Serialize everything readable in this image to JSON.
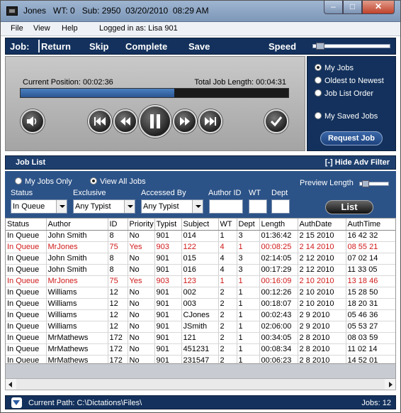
{
  "window": {
    "title_name": "Jones",
    "title_wt": "WT: 0",
    "title_sub": "Sub: 2950",
    "title_date": "03/20/2010",
    "title_time": "08:29 AM"
  },
  "menu": {
    "file": "File",
    "view": "View",
    "help": "Help",
    "logged_in": "Logged in as: Lisa 901"
  },
  "toolbar": {
    "job": "Job:",
    "return": "Return",
    "skip": "Skip",
    "complete": "Complete",
    "save": "Save",
    "speed": "Speed"
  },
  "player": {
    "current_position": "Current Position: 00:02:36",
    "total_length": "Total Job Length: 00:04:31",
    "progress_fraction": 0.575
  },
  "side": {
    "my_jobs": "My Jobs",
    "oldest_to_newest": "Oldest to Newest",
    "job_list_order": "Job List Order",
    "my_saved_jobs": "My Saved Jobs",
    "request_job": "Request Job"
  },
  "joblist": {
    "label": "Job List",
    "hide_adv": "[-] Hide Adv Filter"
  },
  "filter": {
    "my_jobs_only": "My Jobs Only",
    "view_all_jobs": "View All Jobs",
    "preview_length": "Preview Length",
    "status_label": "Status",
    "status_value": "In Queue",
    "exclusive_label": "Exclusive",
    "exclusive_value": "Any Typist",
    "accessed_by_label": "Accessed By",
    "accessed_by_value": "Any Typist",
    "author_id_label": "Author ID",
    "wt_label": "WT",
    "dept_label": "Dept",
    "list_button": "List"
  },
  "table": {
    "columns": [
      "Status",
      "Author",
      "ID",
      "Priority",
      "Typist",
      "Subject",
      "WT",
      "Dept",
      "Length",
      "AuthDate",
      "AuthTime"
    ],
    "rows": [
      {
        "c": [
          "In Queue",
          "John Smith",
          "8",
          "No",
          "901",
          "014",
          "1",
          "3",
          "01:36:42",
          "2 15 2010",
          "16 42 32"
        ],
        "red": false
      },
      {
        "c": [
          "In Queue",
          "MrJones",
          "75",
          "Yes",
          "903",
          "122",
          "4",
          "1",
          "00:08:25",
          "2 14 2010",
          "08 55 21"
        ],
        "red": true
      },
      {
        "c": [
          "In Queue",
          "John Smith",
          "8",
          "No",
          "901",
          "015",
          "4",
          "3",
          "02:14:05",
          "2 12 2010",
          "07 02 14"
        ],
        "red": false
      },
      {
        "c": [
          "In Queue",
          "John Smith",
          "8",
          "No",
          "901",
          "016",
          "4",
          "3",
          "00:17:29",
          "2 12 2010",
          "11 33 05"
        ],
        "red": false
      },
      {
        "c": [
          "In Queue",
          "MrJones",
          "75",
          "Yes",
          "903",
          "123",
          "1",
          "1",
          "00:16:09",
          "2 10 2010",
          "13 18 46"
        ],
        "red": true
      },
      {
        "c": [
          "In Queue",
          "Williams",
          "12",
          "No",
          "901",
          "002",
          "2",
          "1",
          "00:12:26",
          "2 10 2010",
          "15 28 50"
        ],
        "red": false
      },
      {
        "c": [
          "In Queue",
          "Williams",
          "12",
          "No",
          "901",
          "003",
          "2",
          "1",
          "00:18:07",
          "2 10 2010",
          "18 20 31"
        ],
        "red": false
      },
      {
        "c": [
          "In Queue",
          "Williams",
          "12",
          "No",
          "901",
          "CJones",
          "2",
          "1",
          "00:02:43",
          "2 9 2010",
          "05 46 36"
        ],
        "red": false
      },
      {
        "c": [
          "In Queue",
          "Williams",
          "12",
          "No",
          "901",
          "JSmith",
          "2",
          "1",
          "02:06:00",
          "2 9 2010",
          "05 53 27"
        ],
        "red": false
      },
      {
        "c": [
          "In Queue",
          "MrMathews",
          "172",
          "No",
          "901",
          "121",
          "2",
          "1",
          "00:34:05",
          "2 8 2010",
          "08 03 59"
        ],
        "red": false
      },
      {
        "c": [
          "In Queue",
          "MrMathews",
          "172",
          "No",
          "901",
          "451231",
          "2",
          "1",
          "00:08:34",
          "2 8 2010",
          "11 02 14"
        ],
        "red": false
      },
      {
        "c": [
          "In Queue",
          "MrMathews",
          "172",
          "No",
          "901",
          "231547",
          "2",
          "1",
          "00:06:23",
          "2 8 2010",
          "14 52 01"
        ],
        "red": false
      }
    ]
  },
  "status": {
    "path": "Current Path: C:\\Dictations\\Files\\",
    "jobs": "Jobs: 12"
  }
}
